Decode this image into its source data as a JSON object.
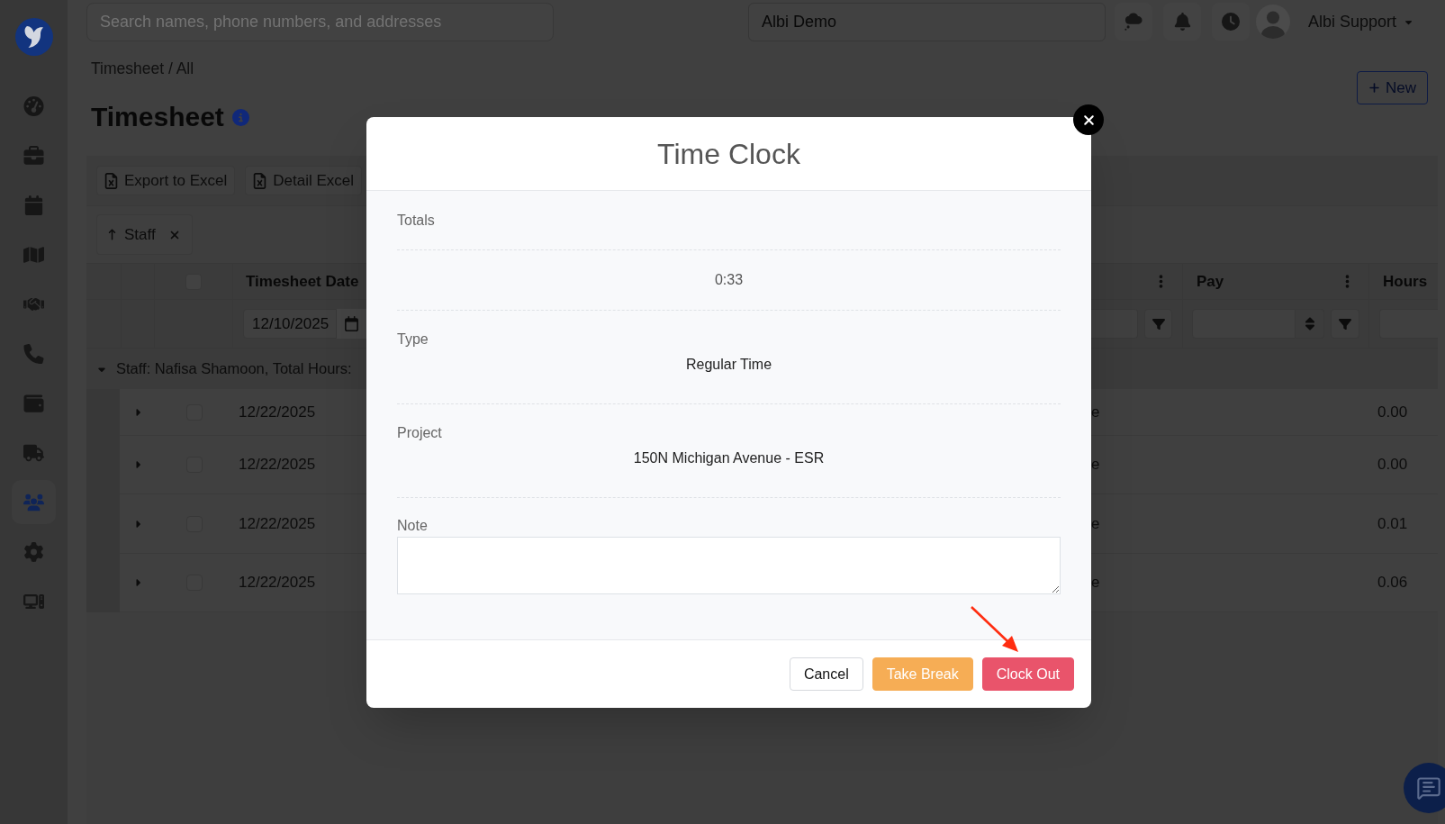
{
  "header": {
    "search": {
      "placeholder": "Search names, phone numbers, and addresses"
    },
    "organization": {
      "value": "Albi Demo"
    },
    "user": {
      "name": "Albi Support"
    }
  },
  "sidebar": {
    "items": [
      {
        "selected": false
      },
      {
        "selected": false
      },
      {
        "selected": false
      },
      {
        "selected": false
      },
      {
        "selected": false
      },
      {
        "selected": false
      },
      {
        "selected": false
      },
      {
        "selected": false
      },
      {
        "selected": true
      },
      {
        "selected": false
      },
      {
        "selected": false
      }
    ]
  },
  "breadcrumb": "Timesheet / All",
  "title": "Timesheet",
  "new_button": "New",
  "toolbar": {
    "buttons": [
      "Export to Excel",
      "Detail Excel"
    ]
  },
  "group_by": [
    {
      "label": "Staff",
      "ascending": true
    }
  ],
  "table": {
    "all_checked": false,
    "columns": [
      {
        "label": "Timesheet Date",
        "filter_value": "12/10/2025"
      },
      {
        "label": "Pay"
      },
      {
        "label": "Hours"
      }
    ],
    "group": {
      "label": "Staff: Nafisa Shamoon, Total Hours:",
      "expanded": true
    },
    "rows": [
      {
        "expanded": false,
        "checked": false,
        "timesheet_date": "12/22/2025",
        "column_5": "e",
        "hours": "0.00"
      },
      {
        "expanded": false,
        "checked": false,
        "timesheet_date": "12/22/2025",
        "column_5": "e",
        "hours": "0.00"
      },
      {
        "expanded": false,
        "checked": false,
        "timesheet_date": "12/22/2025",
        "column_5": "e",
        "hours": "0.01"
      },
      {
        "expanded": false,
        "checked": false,
        "timesheet_date": "12/22/2025",
        "column_5": "e",
        "hours": "0.06"
      }
    ]
  },
  "modal": {
    "title": "Time Clock",
    "sections": [
      {
        "kind": "total",
        "label": "Totals",
        "value": "0:33"
      },
      {
        "kind": "field",
        "label": "Type",
        "value": "Regular Time"
      },
      {
        "kind": "field",
        "label": "Project",
        "value": "150N Michigan Avenue - ESR"
      }
    ],
    "note": {
      "label": "Note"
    },
    "buttons": [
      {
        "label": "Cancel",
        "kind": "secondary"
      },
      {
        "label": "Take Break",
        "kind": "warning"
      },
      {
        "label": "Clock Out",
        "kind": "danger"
      }
    ]
  }
}
